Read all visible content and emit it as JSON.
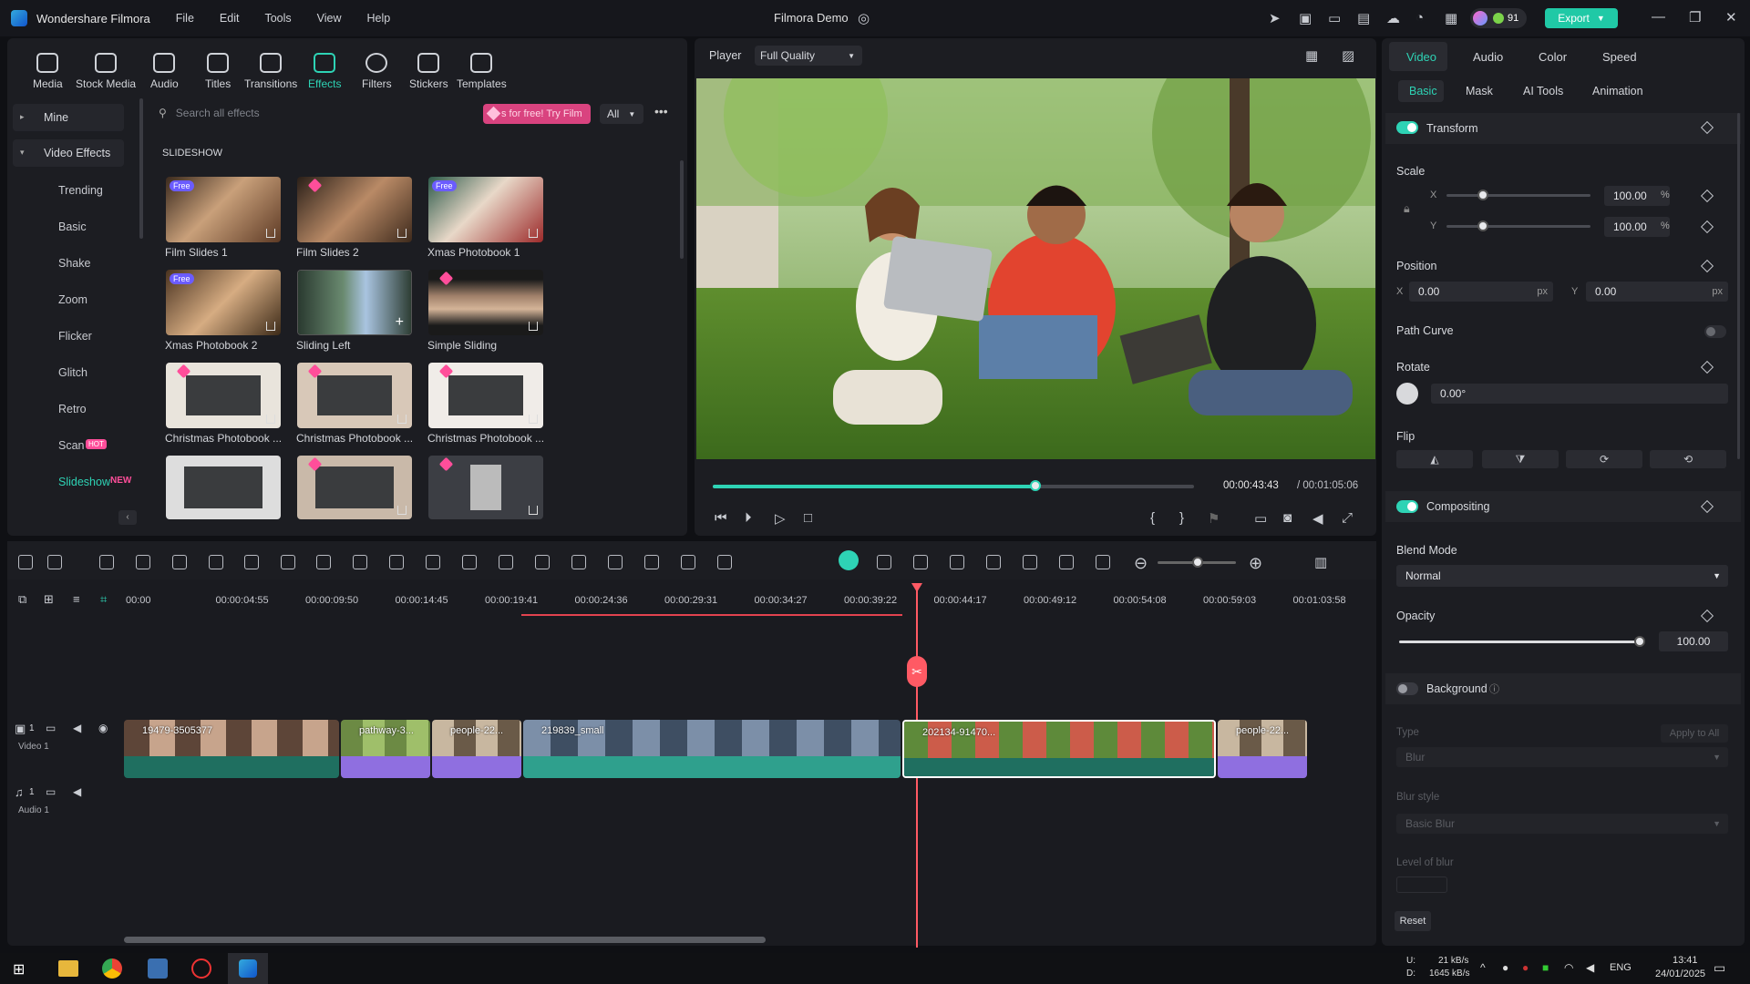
{
  "titlebar": {
    "app_name": "Wondershare Filmora",
    "menus": [
      "File",
      "Edit",
      "Tools",
      "View",
      "Help"
    ],
    "project": "Filmora Demo",
    "credits": "91",
    "export_label": "Export"
  },
  "toolbar": {
    "tools": [
      "Media",
      "Stock Media",
      "Audio",
      "Titles",
      "Transitions",
      "Effects",
      "Filters",
      "Stickers",
      "Templates"
    ],
    "active": "Effects"
  },
  "effects": {
    "categories": {
      "mine": "Mine",
      "video_effects": "Video Effects"
    },
    "subcategories": [
      "Trending",
      "Basic",
      "Shake",
      "Zoom",
      "Flicker",
      "Glitch",
      "Retro",
      "Scan",
      "Slideshow"
    ],
    "scan_badge": "HOT",
    "slideshow_badge": "NEW",
    "search_placeholder": "Search all effects",
    "promo": "s for free! Try Film",
    "filter_value": "All",
    "section_title": "SLIDESHOW",
    "items": [
      "Film Slides 1",
      "Film Slides 2",
      "Xmas Photobook 1",
      "Xmas Photobook 2",
      "Sliding Left",
      "Simple Sliding",
      "Christmas Photobook ...",
      "Christmas Photobook ...",
      "Christmas Photobook ..."
    ],
    "free_badge": "Free"
  },
  "player": {
    "label": "Player",
    "quality": "Full Quality",
    "current_time": "00:00:43:43",
    "total_time": "/ 00:01:05:06",
    "progress": 0.67
  },
  "properties": {
    "tabs": [
      "Video",
      "Audio",
      "Color",
      "Speed"
    ],
    "subtabs": [
      "Basic",
      "Mask",
      "AI Tools",
      "Animation"
    ],
    "transform": "Transform",
    "scale": "Scale",
    "scale_x_label": "X",
    "scale_y_label": "Y",
    "scale_x": "100.00",
    "scale_y": "100.00",
    "percent": "%",
    "position": "Position",
    "pos_x_label": "X",
    "pos_y_label": "Y",
    "pos_x": "0.00",
    "pos_y": "0.00",
    "px": "px",
    "path_curve": "Path Curve",
    "rotate": "Rotate",
    "rotate_value": "0.00°",
    "flip": "Flip",
    "compositing": "Compositing",
    "blend_mode_label": "Blend Mode",
    "blend_mode": "Normal",
    "opacity_label": "Opacity",
    "opacity": "100.00",
    "background": "Background",
    "type_label": "Type",
    "apply_all": "Apply to All",
    "type_value": "Blur",
    "blur_style_label": "Blur style",
    "blur_style": "Basic Blur",
    "level_label": "Level of blur",
    "reset": "Reset"
  },
  "timeline": {
    "ticks": [
      "00:00",
      "00:00:04:55",
      "00:00:09:50",
      "00:00:14:45",
      "00:00:19:41",
      "00:00:24:36",
      "00:00:29:31",
      "00:00:34:27",
      "00:00:39:22",
      "00:00:44:17",
      "00:00:49:12",
      "00:00:54:08",
      "00:00:59:03",
      "00:01:03:58"
    ],
    "video_track": "Video 1",
    "audio_track": "Audio 1",
    "track_num_video": "1",
    "track_num_audio": "1",
    "clips": [
      "19479-3505377",
      "pathway-3...",
      "people-22...",
      "219839_small",
      "202134-91470...",
      "people-22..."
    ]
  },
  "taskbar": {
    "up": "U:",
    "down": "D:",
    "up_rate": "21 kB/s",
    "down_rate": "1645 kB/s",
    "lang": "ENG",
    "time": "13:41",
    "date": "24/01/2025"
  }
}
